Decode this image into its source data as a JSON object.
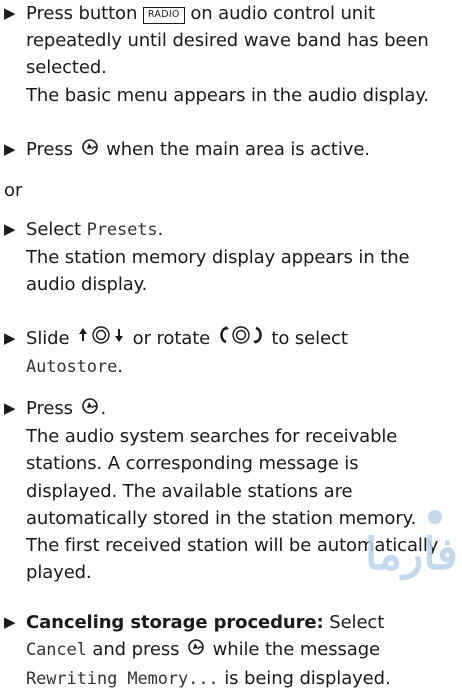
{
  "steps": {
    "s1": {
      "t1": "Press button ",
      "key": "RADIO",
      "t2": " on audio control unit repeatedly until desired wave band has been selected.",
      "result": "The basic menu appears in the audio display."
    },
    "s2": {
      "t1": "Press ",
      "t2": " when the main area is active."
    },
    "or": "or",
    "s3": {
      "t1": "Select ",
      "mono": "Presets",
      "t2": ".",
      "result": "The station memory display appears in the audio display."
    },
    "s4": {
      "t1": "Slide ",
      "t2": " or rotate ",
      "t3": " to select ",
      "mono": "Autostore",
      "t4": "."
    },
    "s5": {
      "t1": "Press ",
      "t2": ".",
      "result": "The audio system searches for receivable stations. A corresponding message is displayed. The available stations are automatically stored in the station memory. The first received station will be automatically played."
    },
    "s6": {
      "bold": "Canceling storage procedure:",
      "t1": " Select",
      "mono1": "Cancel",
      "t2": " and press ",
      "t3": " while the message",
      "mono2": "Rewriting Memory...",
      "t4": " is being displayed."
    }
  },
  "icons": {
    "marker": "triangle-bullet-icon",
    "press": "controller-press-icon",
    "slide": "controller-slide-up-down-icon",
    "rotate": "controller-rotate-icon"
  },
  "watermark": {
    "text": "رو فارما"
  },
  "colors": {
    "text": "#1a1a1a",
    "watermark": "#b9d3ee"
  }
}
